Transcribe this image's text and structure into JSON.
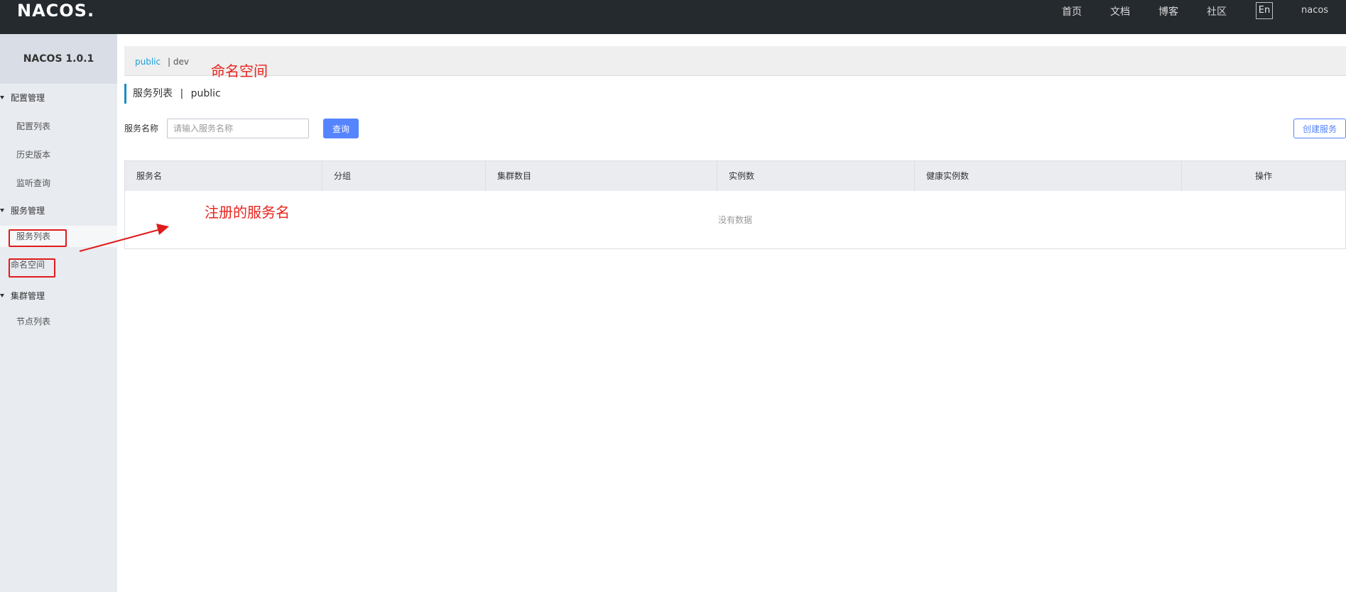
{
  "header": {
    "logo": "NACOS.",
    "nav": [
      "首页",
      "文档",
      "博客",
      "社区"
    ],
    "lang": "En",
    "user": "nacos"
  },
  "sidebar": {
    "title": "NACOS 1.0.1",
    "groups": [
      {
        "label": "配置管理",
        "items": [
          "配置列表",
          "历史版本",
          "监听查询"
        ]
      },
      {
        "label": "服务管理",
        "items": [
          "服务列表",
          "命名空间"
        ]
      },
      {
        "label": "集群管理",
        "items": [
          "节点列表"
        ]
      }
    ]
  },
  "namespaces": {
    "active": "public",
    "other": "| dev"
  },
  "page": {
    "title": "服务列表",
    "separator": "|",
    "namespace": "public"
  },
  "search": {
    "label": "服务名称",
    "placeholder": "请输入服务名称",
    "query_label": "查询",
    "create_label": "创建服务"
  },
  "table": {
    "columns": [
      "服务名",
      "分组",
      "集群数目",
      "实例数",
      "健康实例数",
      "操作"
    ],
    "empty_text": "没有数据"
  },
  "annotations": {
    "namespace_note": "命名空间",
    "service_note": "注册的服务名",
    "color": "#e8231e"
  }
}
